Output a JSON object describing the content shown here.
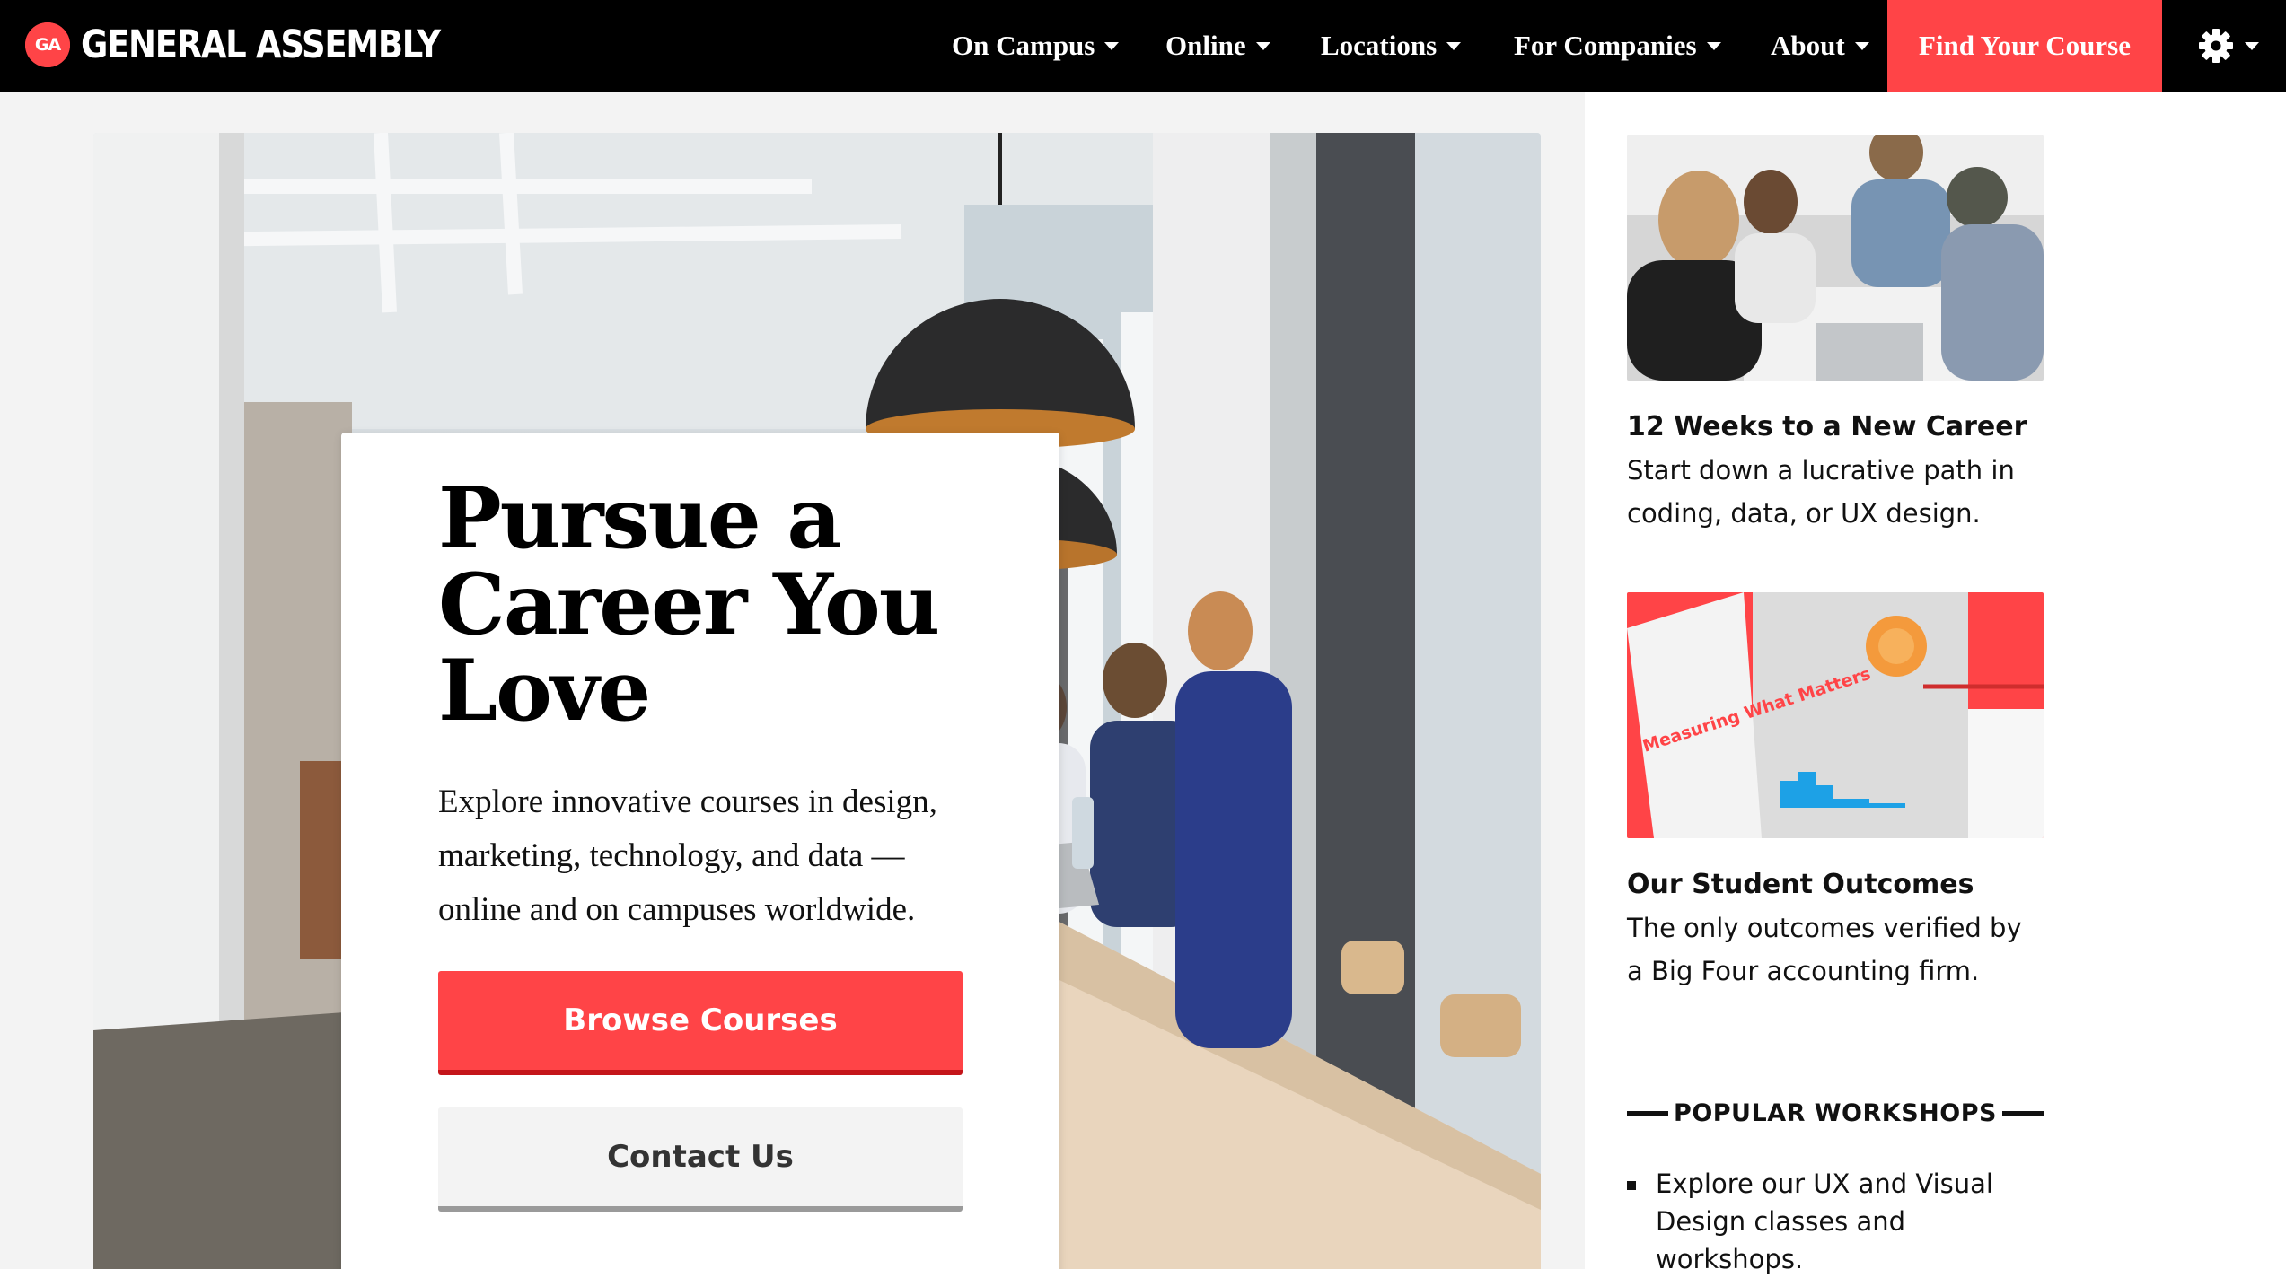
{
  "brand": {
    "logo_badge": "GA",
    "logo_text": "GENERAL ASSEMBLY",
    "accent_color": "#ff4447"
  },
  "nav": {
    "items": [
      {
        "label": "On Campus"
      },
      {
        "label": "Online"
      },
      {
        "label": "Locations"
      },
      {
        "label": "For Companies"
      },
      {
        "label": "About"
      }
    ],
    "cta_label": "Find Your Course",
    "settings_icon": "gear-icon"
  },
  "hero": {
    "title": "Pursue a Career You Love",
    "description": "Explore innovative courses in design, marketing, technology, and data — online and on campuses worldwide.",
    "primary_button": "Browse Courses",
    "secondary_button": "Contact Us"
  },
  "sidebar": {
    "promos": [
      {
        "title": "12 Weeks to a New Career",
        "text": "Start down a lucrative path in coding, data, or UX design."
      },
      {
        "title": "Our Student Outcomes",
        "text": "The only outcomes verified by a Big Four accounting firm.",
        "image_text": "Measuring What Matters"
      }
    ],
    "workshops": {
      "heading": "POPULAR WORKSHOPS",
      "items": [
        {
          "text": "Explore our UX and Visual Design classes and workshops."
        }
      ]
    }
  }
}
